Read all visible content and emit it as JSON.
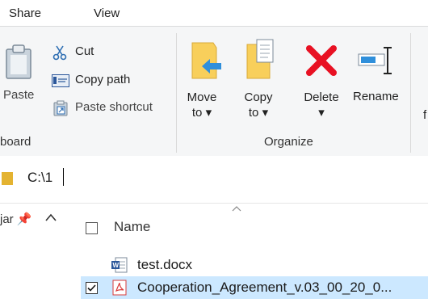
{
  "tabs": [
    "Share",
    "View"
  ],
  "clipboard": {
    "paste_label": "Paste",
    "cut_label": "Cut",
    "copy_path_label": "Copy path",
    "paste_shortcut_label": "Paste shortcut",
    "group_label": "board"
  },
  "organize": {
    "move_to_label_1": "Move",
    "move_to_label_2": "to",
    "copy_to_label_1": "Copy",
    "copy_to_label_2": "to",
    "delete_label": "Delete",
    "rename_label": "Rename",
    "group_label": "Organize"
  },
  "address": {
    "path": "C:\\1"
  },
  "nav": {
    "pinned_label": "jar"
  },
  "list": {
    "column_name": "Name",
    "rows": [
      {
        "name": "test.docx",
        "icon": "word-doc-icon",
        "selected": false
      },
      {
        "name": "Cooperation_Agreement_v.03_00_20_0...",
        "icon": "pdf-icon",
        "selected": true
      }
    ]
  },
  "colors": {
    "ribbon_bg": "#f5f6f7",
    "selection_bg": "#cce8ff",
    "delete_red": "#e81123",
    "folder_yellow": "#f8cf5b",
    "arrow_blue": "#2f8fdb"
  }
}
